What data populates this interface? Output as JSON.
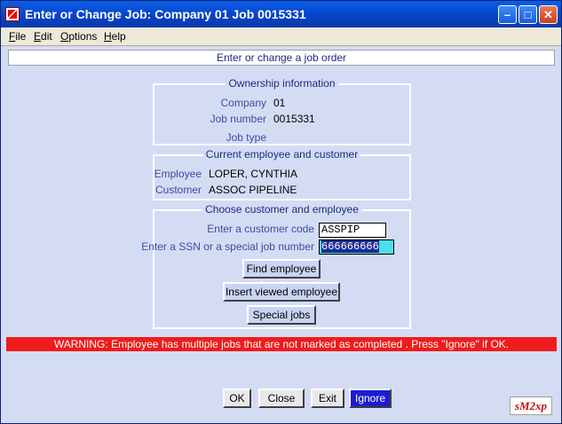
{
  "window": {
    "title": "Enter or Change Job:  Company 01  Job 0015331",
    "controls": {
      "minimize": "–",
      "maximize": "□",
      "close": "✕"
    }
  },
  "menu": [
    "File",
    "Edit",
    "Options",
    "Help"
  ],
  "header": "Enter or change a job order",
  "ownership": {
    "legend": "Ownership information",
    "company_label": "Company",
    "company_value": "01",
    "job_number_label": "Job number",
    "job_number_value": "0015331",
    "job_type_label": "Job type",
    "job_type_value": ""
  },
  "current": {
    "legend": "Current employee and customer",
    "employee_label": "Employee",
    "employee_value": "LOPER, CYNTHIA",
    "customer_label": "Customer",
    "customer_value": "ASSOC PIPELINE"
  },
  "choose": {
    "legend": "Choose customer and employee",
    "customer_code_label": "Enter a customer code",
    "customer_code_value": "ASSPIP",
    "ssn_label": "Enter a SSN or a special job number",
    "ssn_value": "666666666",
    "find_employee": "Find employee",
    "insert_viewed": "Insert viewed employee",
    "special_jobs": "Special jobs"
  },
  "warning": "WARNING: Employee has multiple jobs that are not marked as completed . Press \"Ignore\" if OK.",
  "footer": {
    "ok": "OK",
    "close": "Close",
    "exit": "Exit",
    "ignore": "Ignore"
  },
  "logo_text": "sM2xp",
  "colors": {
    "warning_bg": "#ee1c1c",
    "window_bg": "#d4dcf4",
    "primary_button": "#1c1cd4"
  }
}
